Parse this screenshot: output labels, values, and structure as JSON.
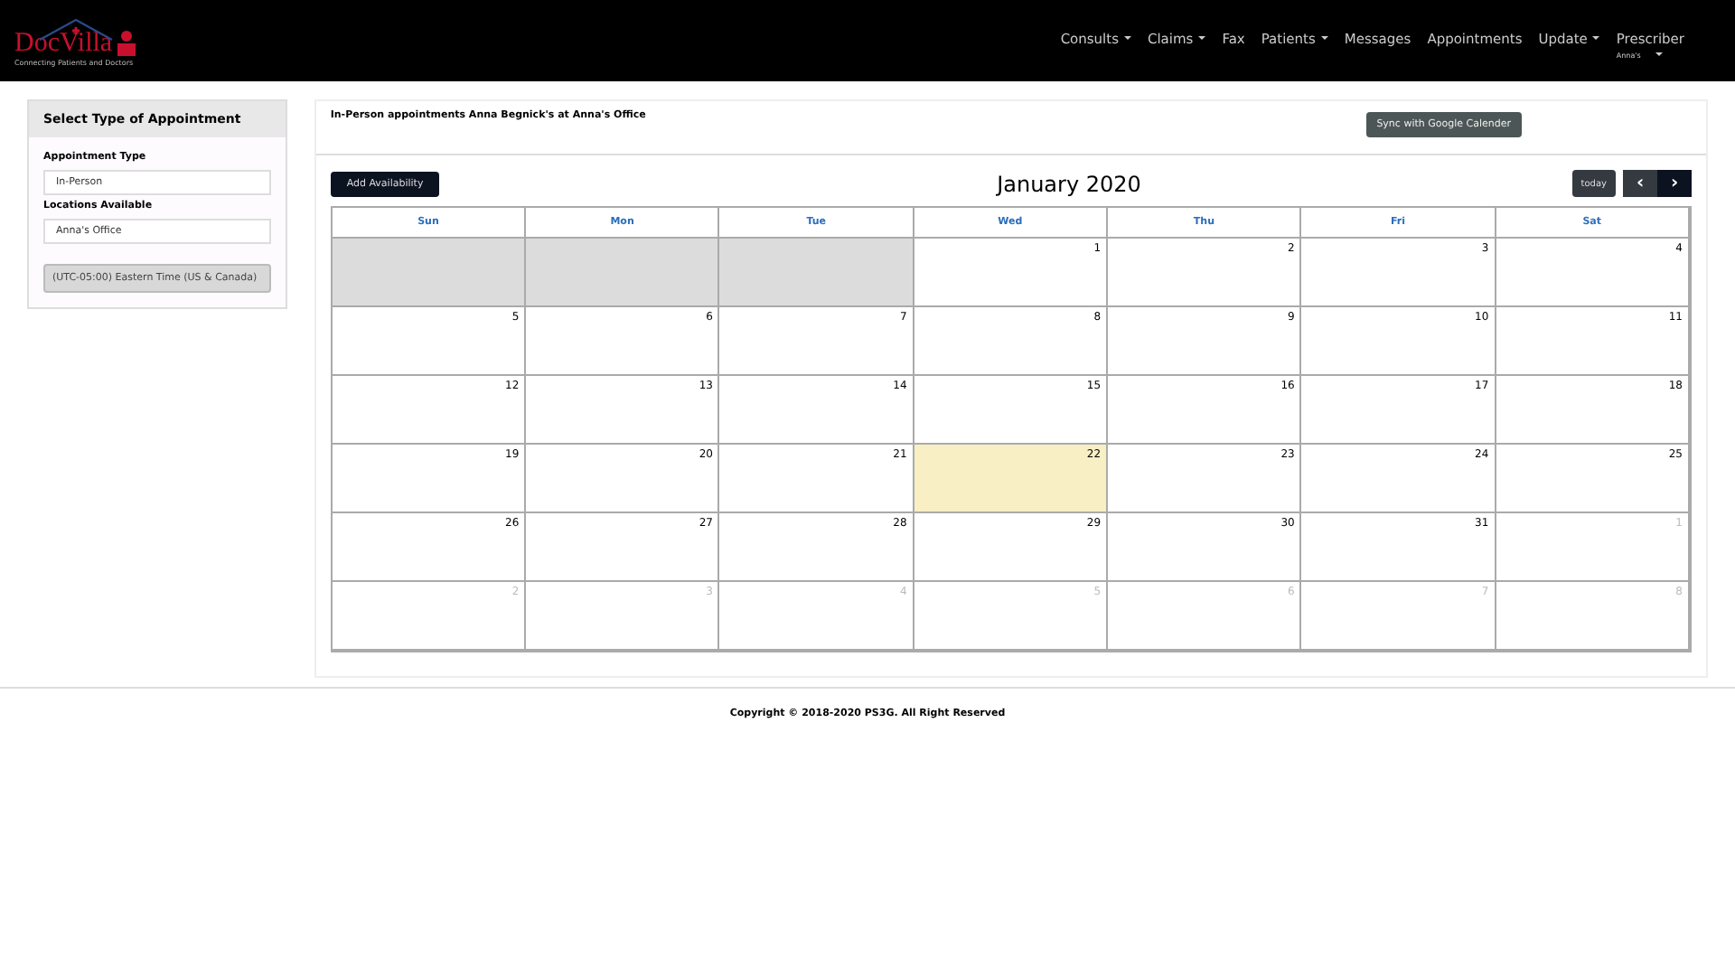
{
  "header": {
    "logo": {
      "name": "DocVilla",
      "tagline": "Connecting Patients and Doctors"
    },
    "nav": [
      {
        "label": "Consults",
        "dropdown": true
      },
      {
        "label": "Claims",
        "dropdown": true
      },
      {
        "label": "Fax",
        "dropdown": false
      },
      {
        "label": "Patients",
        "dropdown": true
      },
      {
        "label": "Messages",
        "dropdown": false
      },
      {
        "label": "Appointments",
        "dropdown": false
      },
      {
        "label": "Update",
        "dropdown": true
      }
    ],
    "user": {
      "label": "Prescriber",
      "name": "Anna's"
    }
  },
  "sidebar": {
    "title": "Select Type of Appointment",
    "fields": [
      {
        "label": "Appointment Type",
        "value": "In-Person"
      },
      {
        "label": "Locations Available",
        "value": "Anna's Office"
      }
    ],
    "timezone": "(UTC-05:00) Eastern Time (US & Canada)"
  },
  "main": {
    "heading": "In-Person appointments Anna Begnick's at Anna's Office",
    "sync_button": "Sync with Google Calender",
    "add_button": "Add Availability",
    "month": "January 2020",
    "today_button": "today",
    "prev": "‹",
    "next": "›",
    "weekdays": [
      "Sun",
      "Mon",
      "Tue",
      "Wed",
      "Thu",
      "Fri",
      "Sat"
    ],
    "weeks": [
      [
        {
          "kind": "blank"
        },
        {
          "kind": "blank"
        },
        {
          "kind": "blank"
        },
        {
          "kind": "current",
          "day": "1",
          "today": false
        },
        {
          "kind": "current",
          "day": "2",
          "today": false
        },
        {
          "kind": "current",
          "day": "3",
          "today": false
        },
        {
          "kind": "current",
          "day": "4",
          "today": false
        }
      ],
      [
        {
          "kind": "current",
          "day": "5",
          "today": false
        },
        {
          "kind": "current",
          "day": "6",
          "today": false
        },
        {
          "kind": "current",
          "day": "7",
          "today": false
        },
        {
          "kind": "current",
          "day": "8",
          "today": false
        },
        {
          "kind": "current",
          "day": "9",
          "today": false
        },
        {
          "kind": "current",
          "day": "10",
          "today": false
        },
        {
          "kind": "current",
          "day": "11",
          "today": false
        }
      ],
      [
        {
          "kind": "current",
          "day": "12",
          "today": false
        },
        {
          "kind": "current",
          "day": "13",
          "today": false
        },
        {
          "kind": "current",
          "day": "14",
          "today": false
        },
        {
          "kind": "current",
          "day": "15",
          "today": false
        },
        {
          "kind": "current",
          "day": "16",
          "today": false
        },
        {
          "kind": "current",
          "day": "17",
          "today": false
        },
        {
          "kind": "current",
          "day": "18",
          "today": false
        }
      ],
      [
        {
          "kind": "current",
          "day": "19",
          "today": false
        },
        {
          "kind": "current",
          "day": "20",
          "today": false
        },
        {
          "kind": "current",
          "day": "21",
          "today": false
        },
        {
          "kind": "current",
          "day": "22",
          "today": true
        },
        {
          "kind": "current",
          "day": "23",
          "today": false
        },
        {
          "kind": "current",
          "day": "24",
          "today": false
        },
        {
          "kind": "current",
          "day": "25",
          "today": false
        }
      ],
      [
        {
          "kind": "current",
          "day": "26",
          "today": false
        },
        {
          "kind": "current",
          "day": "27",
          "today": false
        },
        {
          "kind": "current",
          "day": "28",
          "today": false
        },
        {
          "kind": "current",
          "day": "29",
          "today": false
        },
        {
          "kind": "current",
          "day": "30",
          "today": false
        },
        {
          "kind": "current",
          "day": "31",
          "today": false
        },
        {
          "kind": "next",
          "day": "1",
          "today": false
        }
      ],
      [
        {
          "kind": "next",
          "day": "2",
          "today": false
        },
        {
          "kind": "next",
          "day": "3",
          "today": false
        },
        {
          "kind": "next",
          "day": "4",
          "today": false
        },
        {
          "kind": "next",
          "day": "5",
          "today": false
        },
        {
          "kind": "next",
          "day": "6",
          "today": false
        },
        {
          "kind": "next",
          "day": "7",
          "today": false
        },
        {
          "kind": "next",
          "day": "8",
          "today": false
        }
      ]
    ]
  },
  "footer": {
    "copyright": "Copyright © 2018-2020 PS3G. All Right Reserved"
  }
}
